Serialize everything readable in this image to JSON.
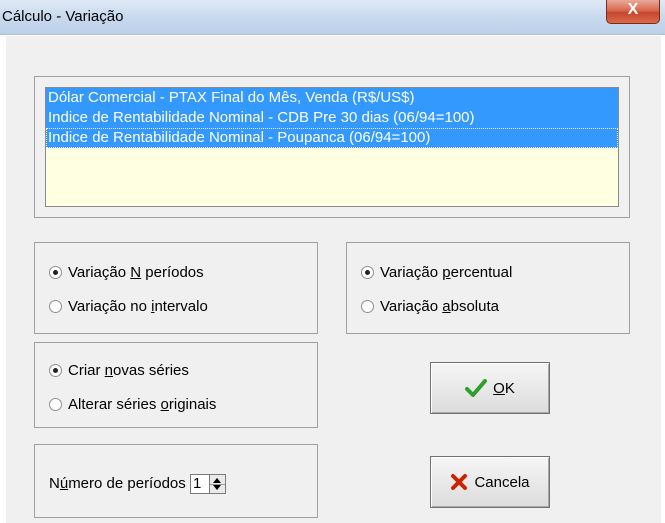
{
  "window": {
    "title": "Cálculo - Variação",
    "close_glyph": "X"
  },
  "series_list": {
    "items": [
      {
        "label": "Dólar Comercial - PTAX Final do Mês, Venda (R$/US$)",
        "selected": true
      },
      {
        "label": "Indice de Rentabilidade Nominal - CDB Pre 30 dias (06/94=100)",
        "selected": true
      },
      {
        "label": "Indice de Rentabilidade Nominal - Poupanca (06/94=100)",
        "selected": true,
        "focused": true
      }
    ]
  },
  "period_mode": {
    "options": [
      {
        "label_pre": "Variação ",
        "accel": "N",
        "label_post": " períodos",
        "checked": true
      },
      {
        "label_pre": "Variação no ",
        "accel": "i",
        "label_post": "ntervalo",
        "checked": false
      }
    ]
  },
  "variation_type": {
    "options": [
      {
        "label_pre": "Variação ",
        "accel": "p",
        "label_post": "ercentual",
        "checked": true
      },
      {
        "label_pre": "Variação ",
        "accel": "a",
        "label_post": "bsoluta",
        "checked": false
      }
    ]
  },
  "series_output": {
    "options": [
      {
        "label_pre": "Criar ",
        "accel": "n",
        "label_post": "ovas séries",
        "checked": true
      },
      {
        "label_pre": "Alterar séries ",
        "accel": "o",
        "label_post": "riginais",
        "checked": false
      }
    ]
  },
  "periods": {
    "label_pre": "N",
    "accel": "ú",
    "label_post": "mero de períodos",
    "value": "1"
  },
  "buttons": {
    "ok": {
      "accel": "O",
      "label_post": "K",
      "icon": "checkmark-icon",
      "icon_color": "#2e9e2e"
    },
    "cancel": {
      "label": "Cancela",
      "icon": "x-mark-icon",
      "icon_color": "#cc2200"
    }
  }
}
